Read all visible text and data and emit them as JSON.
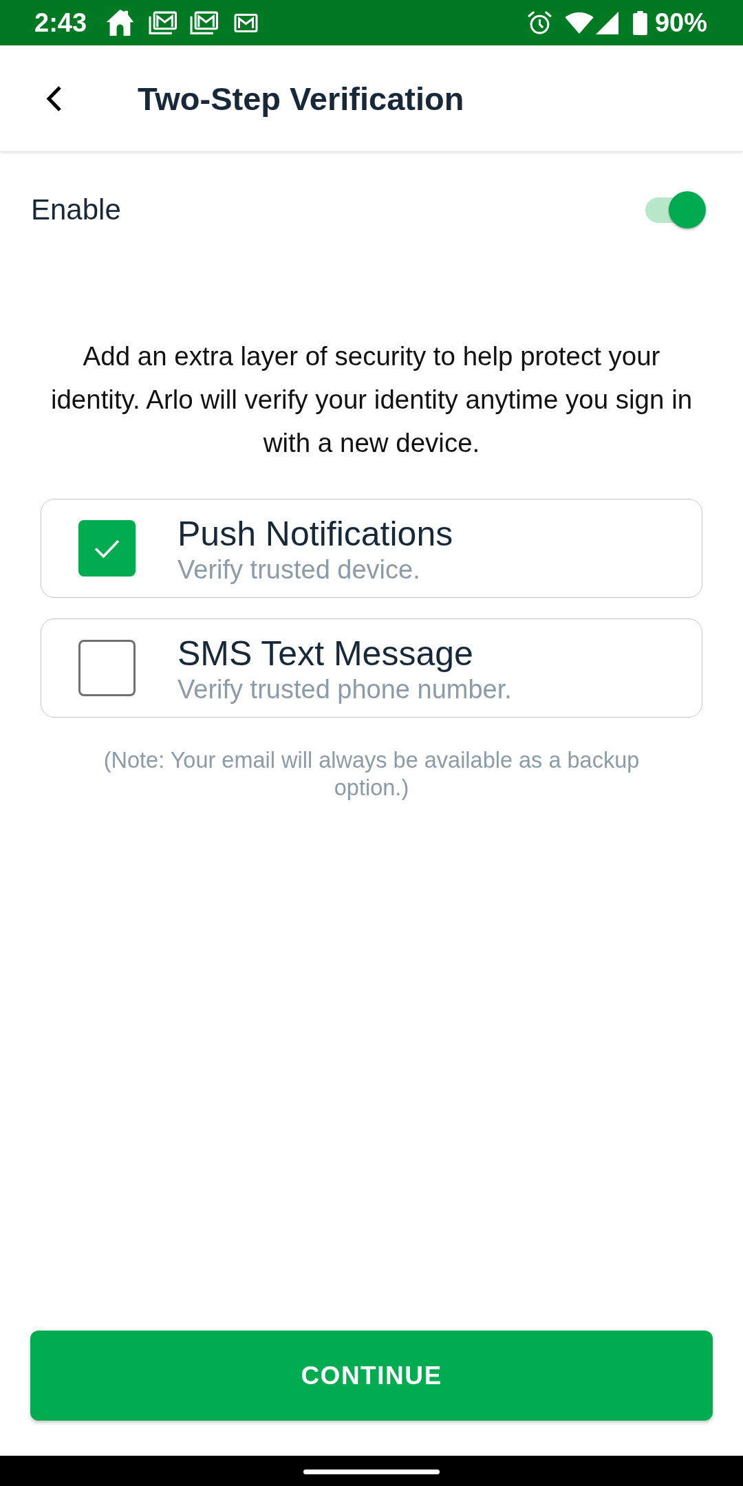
{
  "status_bar": {
    "time": "2:43",
    "battery": "90%"
  },
  "header": {
    "title": "Two-Step Verification"
  },
  "enable": {
    "label": "Enable",
    "on": true
  },
  "description": "Add an extra layer of security to help protect your identity. Arlo will verify your identity anytime you sign in with a new device.",
  "methods": [
    {
      "title": "Push Notifications",
      "subtitle": "Verify trusted device.",
      "checked": true
    },
    {
      "title": "SMS Text Message",
      "subtitle": "Verify trusted phone number.",
      "checked": false
    }
  ],
  "note": "(Note: Your email will always be available as a backup option.)",
  "continue_button": "CONTINUE"
}
